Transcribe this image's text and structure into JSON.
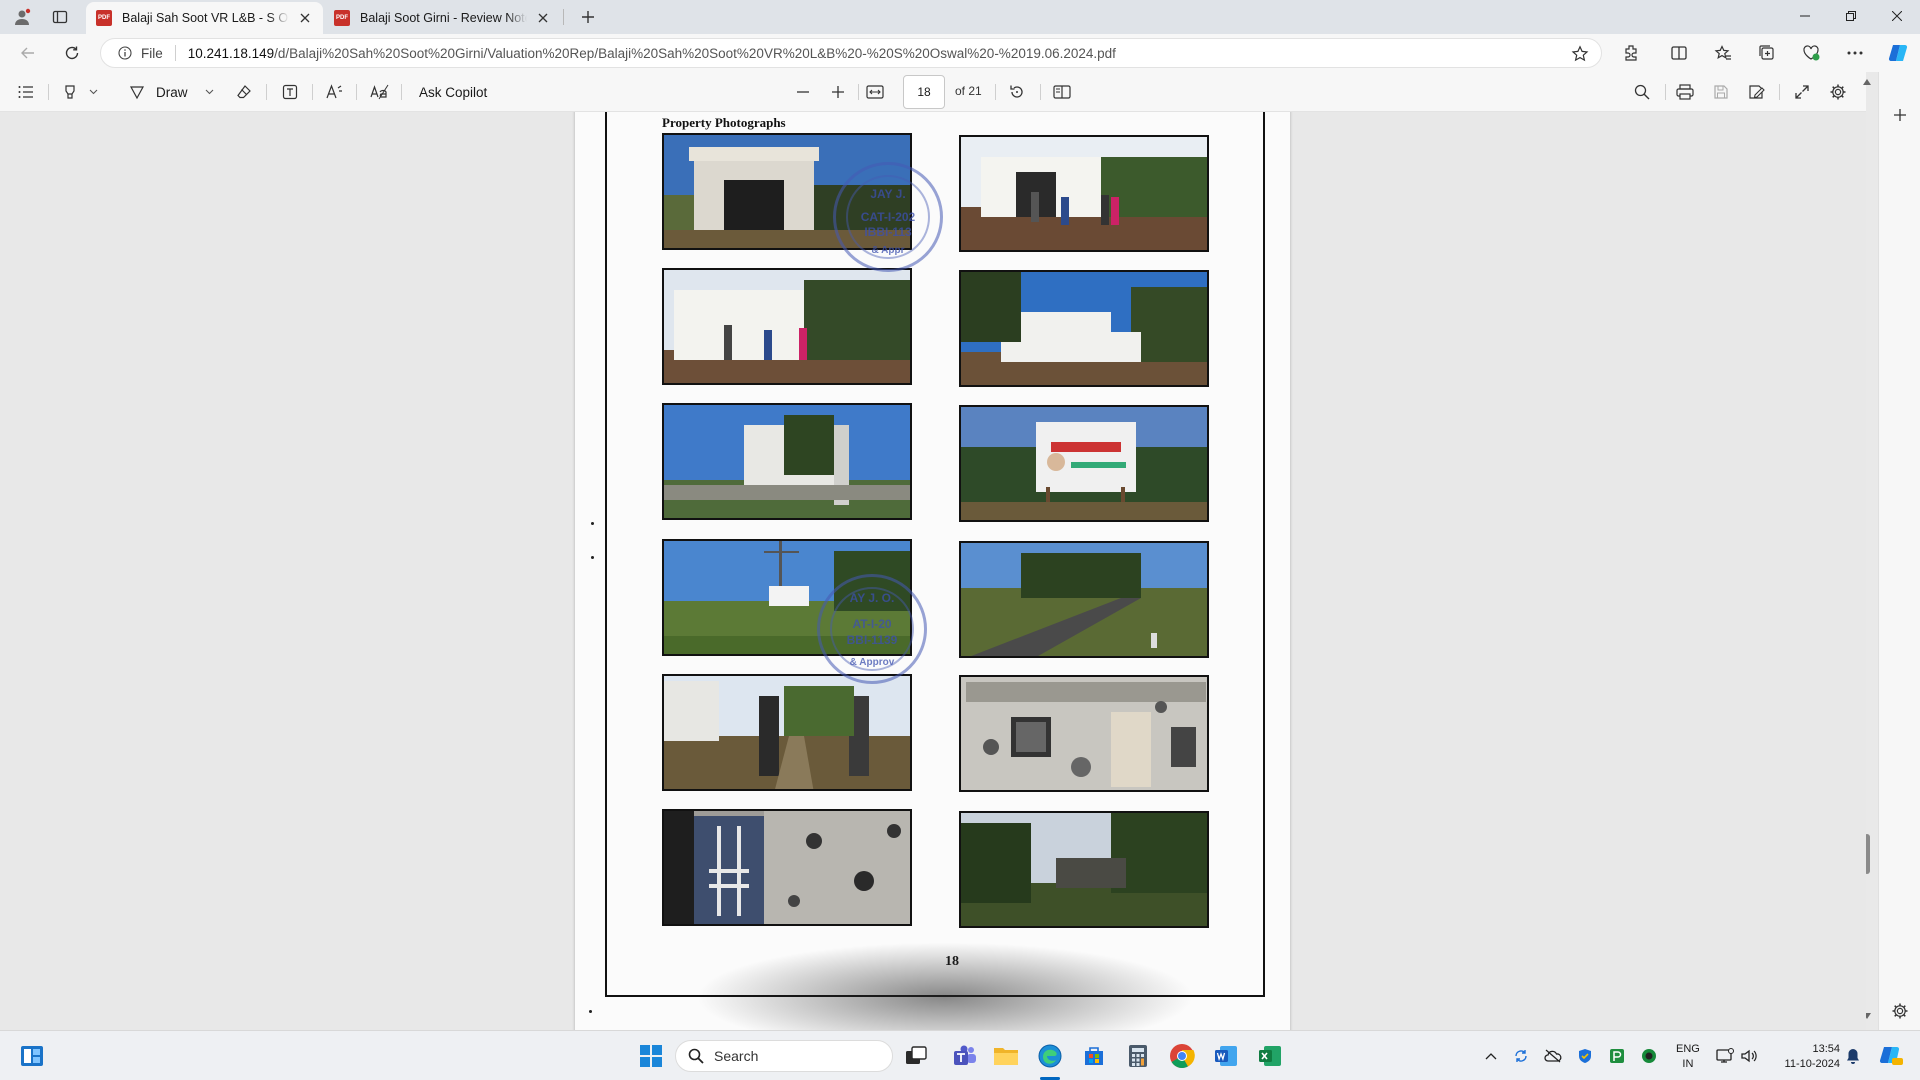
{
  "tabs": [
    {
      "title": "Balaji Sah Soot VR L&B - S Oswal",
      "active": true
    },
    {
      "title": "Balaji Soot Girni - Review Note - S",
      "active": false
    }
  ],
  "address": {
    "file_label": "File",
    "url_host": "10.241.18.149",
    "url_path": "/d/Balaji%20Sah%20Soot%20Girni/Valuation%20Rep/Balaji%20Sah%20Soot%20VR%20L&B%20-%20S%20Oswal%20-%2019.06.2024.pdf"
  },
  "pdf_toolbar": {
    "draw_label": "Draw",
    "ask_copilot_label": "Ask Copilot",
    "current_page": "18",
    "total_pages": "of 21"
  },
  "document": {
    "heading": "Property Photographs",
    "page_number": "18",
    "stamp_top": {
      "name": "JAY J.",
      "cat": "CAT-I-202",
      "ibbi": "IBBI-113",
      "seal": "& Appr"
    },
    "stamp_bottom": {
      "name": "AY J. O.",
      "cat": "AT-I-20",
      "ibbi": "BBI-1139",
      "seal": "& Approv"
    },
    "photos": [
      {
        "description": "building-facade"
      },
      {
        "description": "factory-entrance-with-people"
      },
      {
        "description": "white-building-with-people"
      },
      {
        "description": "white-building-trees"
      },
      {
        "description": "building-side-trees"
      },
      {
        "description": "signboard-banner"
      },
      {
        "description": "open-land-poles"
      },
      {
        "description": "road-trees"
      },
      {
        "description": "gate-entrance"
      },
      {
        "description": "old-wall-structure"
      },
      {
        "description": "dark-door-wall"
      },
      {
        "description": "trees-and-structure"
      }
    ]
  },
  "taskbar": {
    "search_placeholder": "Search",
    "language_line1": "ENG",
    "language_line2": "IN",
    "time": "13:54",
    "date": "11-10-2024"
  },
  "colors": {
    "accent_blue": "#0067c0",
    "pdf_red": "#c8312a",
    "stamp_blue": "#3c50af"
  }
}
